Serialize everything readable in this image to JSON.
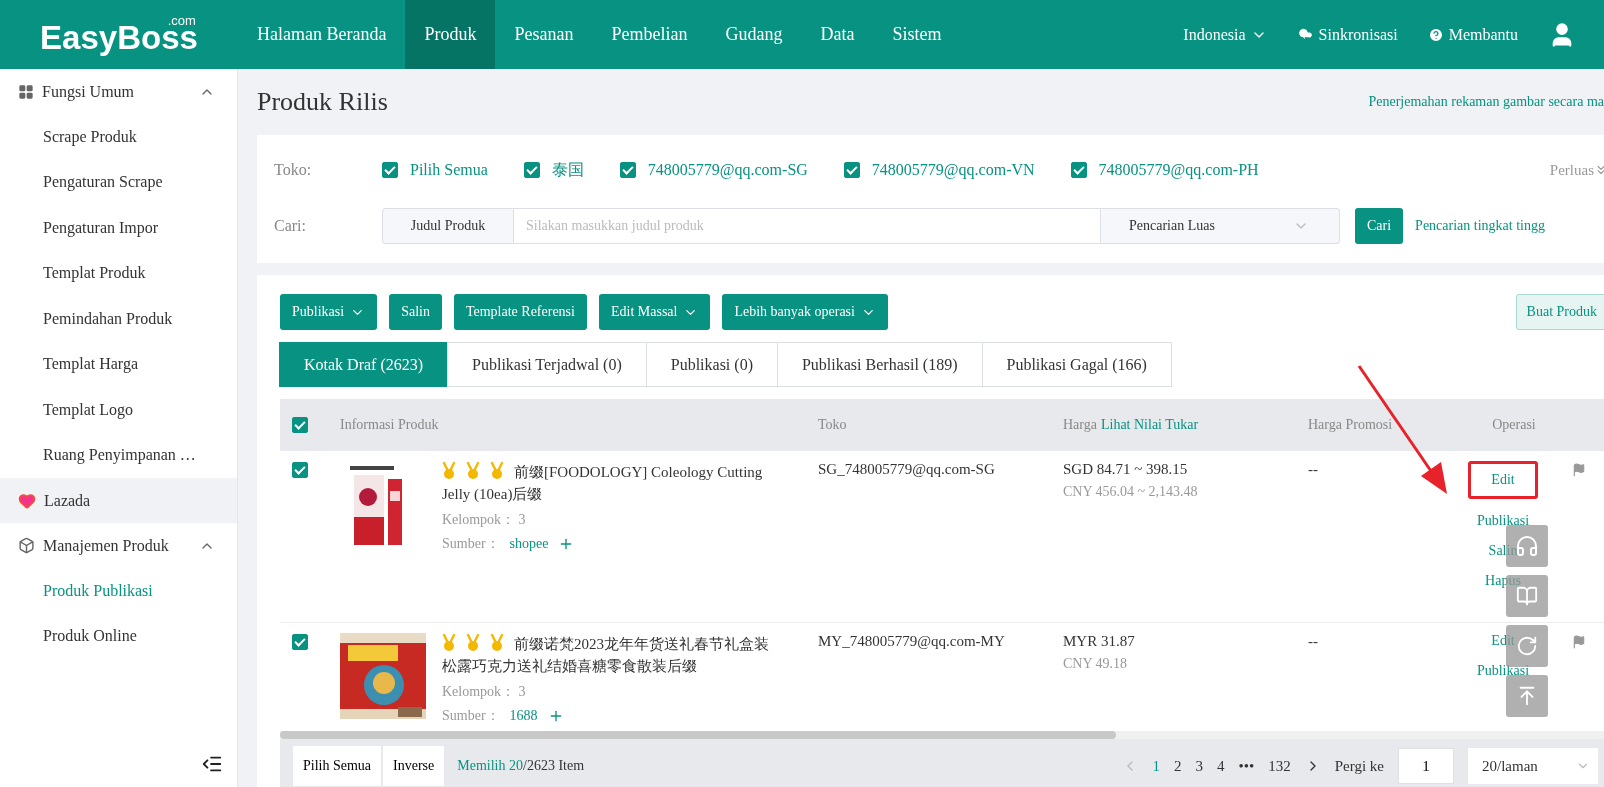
{
  "nav": {
    "logo": "EasyBoss",
    "logo_suffix": ".com",
    "items": [
      {
        "label": "Halaman Beranda",
        "selected": false
      },
      {
        "label": "Produk",
        "selected": true
      },
      {
        "label": "Pesanan",
        "selected": false
      },
      {
        "label": "Pembelian",
        "selected": false
      },
      {
        "label": "Gudang",
        "selected": false
      },
      {
        "label": "Data",
        "selected": false
      },
      {
        "label": "Sistem",
        "selected": false
      }
    ],
    "language": "Indonesia",
    "sync": "Sinkronisasi",
    "help": "Membantu"
  },
  "sidebar": {
    "groups": [
      {
        "label": "Fungsi Umum",
        "kind": "grid",
        "expanded": true,
        "hovered": false,
        "children": [
          {
            "label": "Scrape Produk",
            "selected": false
          },
          {
            "label": "Pengaturan Scrape",
            "selected": false
          },
          {
            "label": "Pengaturan Impor",
            "selected": false
          },
          {
            "label": "Templat Produk",
            "selected": false
          },
          {
            "label": "Pemindahan Produk",
            "selected": false
          },
          {
            "label": "Templat Harga",
            "selected": false
          },
          {
            "label": "Templat Logo",
            "selected": false
          },
          {
            "label": "Ruang Penyimpanan …",
            "selected": false
          }
        ]
      },
      {
        "label": "Lazada",
        "kind": "heart",
        "hovered": true
      },
      {
        "label": "Manajemen Produk",
        "kind": "cube",
        "expanded": true,
        "hovered": false,
        "children": [
          {
            "label": "Produk Publikasi",
            "selected": true
          },
          {
            "label": "Produk Online",
            "selected": false
          }
        ]
      }
    ]
  },
  "page": {
    "title": "Produk Rilis",
    "link": "Penerjemahan rekaman gambar secara ma"
  },
  "filter": {
    "shop_label": "Toko:",
    "shops": [
      {
        "label": "Pilih Semua",
        "checked": true
      },
      {
        "label": "泰国",
        "checked": true
      },
      {
        "label": "748005779@qq.com-SG",
        "checked": true
      },
      {
        "label": "748005779@qq.com-VN",
        "checked": true
      },
      {
        "label": "748005779@qq.com-PH",
        "checked": true
      }
    ],
    "expand": "Perluas",
    "search_label": "Cari:",
    "search_field": "Judul Produk",
    "placeholder": "Silakan masukkan judul produk",
    "mode": "Pencarian Luas",
    "search_button": "Cari",
    "advanced": "Pencarian tingkat tingg"
  },
  "toolbar": [
    {
      "label": "Publikasi",
      "dropdown": true
    },
    {
      "label": "Salin",
      "dropdown": false
    },
    {
      "label": "Template Referensi",
      "dropdown": false
    },
    {
      "label": "Edit Massal",
      "dropdown": true
    },
    {
      "label": "Lebih banyak operasi",
      "dropdown": true
    }
  ],
  "create_button": "Buat Produk",
  "tabs": [
    {
      "label": "Kotak Draf (2623)",
      "selected": true
    },
    {
      "label": "Publikasi Terjadwal (0)",
      "selected": false
    },
    {
      "label": "Publikasi (0)",
      "selected": false
    },
    {
      "label": "Publikasi Berhasil (189)",
      "selected": false
    },
    {
      "label": "Publikasi Gagal (166)",
      "selected": false
    }
  ],
  "table": {
    "all_checked": true,
    "columns": [
      "Informasi Produk",
      "Toko",
      "Harga",
      "Harga Promosi",
      "Operasi"
    ],
    "price_link": "Lihat Nilai Tukar",
    "rows": [
      {
        "checked": true,
        "title": "前缀[FOODOLOGY] Coleology Cutting Jelly (10ea)后缀",
        "group_label": "Kelompok：",
        "group": "3",
        "source_label": "Sumber：",
        "source": "shopee",
        "shop": "SG_748005779@qq.com-SG",
        "price": "SGD 84.71 ~ 398.15",
        "price_cny": "CNY 456.04 ~ 2,143.48",
        "promo": "--",
        "actions": [
          {
            "label": "Edit",
            "highlighted": true
          },
          {
            "label": "Publikasi",
            "highlighted": false
          },
          {
            "label": "Salin",
            "highlighted": false
          },
          {
            "label": "Hapus",
            "highlighted": false
          }
        ]
      },
      {
        "checked": true,
        "title": "前缀诺梵2023龙年年货送礼春节礼盒装松露巧克力送礼结婚喜糖零食散装后缀",
        "group_label": "Kelompok：",
        "group": "3",
        "source_label": "Sumber：",
        "source": "1688",
        "shop": "MY_748005779@qq.com-MY",
        "price": "MYR 31.87",
        "price_cny": "CNY 49.18",
        "promo": "--",
        "actions": [
          {
            "label": "Edit",
            "highlighted": false
          },
          {
            "label": "Publikasi",
            "highlighted": false
          }
        ]
      }
    ]
  },
  "footer": {
    "select_all": "Pilih Semua",
    "inverse": "Inverse",
    "selected_count": "Memilih 20",
    "total": "/2623 Item",
    "pages": [
      {
        "label": "1",
        "selected": true
      },
      {
        "label": "2",
        "selected": false
      },
      {
        "label": "3",
        "selected": false
      },
      {
        "label": "4",
        "selected": false
      },
      {
        "label": "•••",
        "selected": false
      },
      {
        "label": "132",
        "selected": false
      }
    ],
    "goto": "Pergi ke",
    "goto_value": "1",
    "page_size": "20/laman"
  }
}
